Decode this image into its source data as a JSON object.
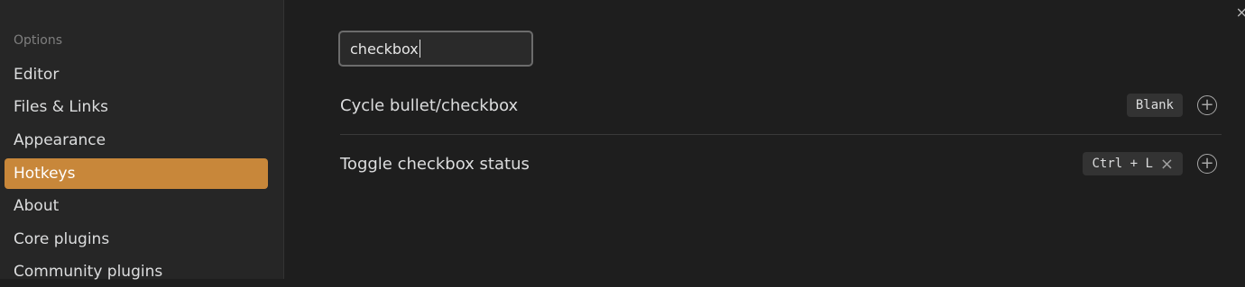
{
  "sidebar": {
    "section_label": "Options",
    "items": [
      {
        "label": "Editor",
        "active": false
      },
      {
        "label": "Files & Links",
        "active": false
      },
      {
        "label": "Appearance",
        "active": false
      },
      {
        "label": "Hotkeys",
        "active": true
      },
      {
        "label": "About",
        "active": false
      },
      {
        "label": "Core plugins",
        "active": false
      },
      {
        "label": "Community plugins",
        "active": false
      }
    ]
  },
  "search": {
    "value": "checkbox"
  },
  "hotkeys": [
    {
      "label": "Cycle bullet/checkbox",
      "hotkey": "Blank",
      "removable": false,
      "add_icon": "plus-circle-icon"
    },
    {
      "label": "Toggle checkbox status",
      "hotkey": "Ctrl + L",
      "removable": true,
      "remove_icon": "close-icon",
      "add_icon": "plus-circle-icon"
    }
  ],
  "window": {
    "close_icon": "close-icon"
  },
  "colors": {
    "accent": "#c8873a",
    "background": "#1e1e1e",
    "sidebar": "#262626"
  }
}
